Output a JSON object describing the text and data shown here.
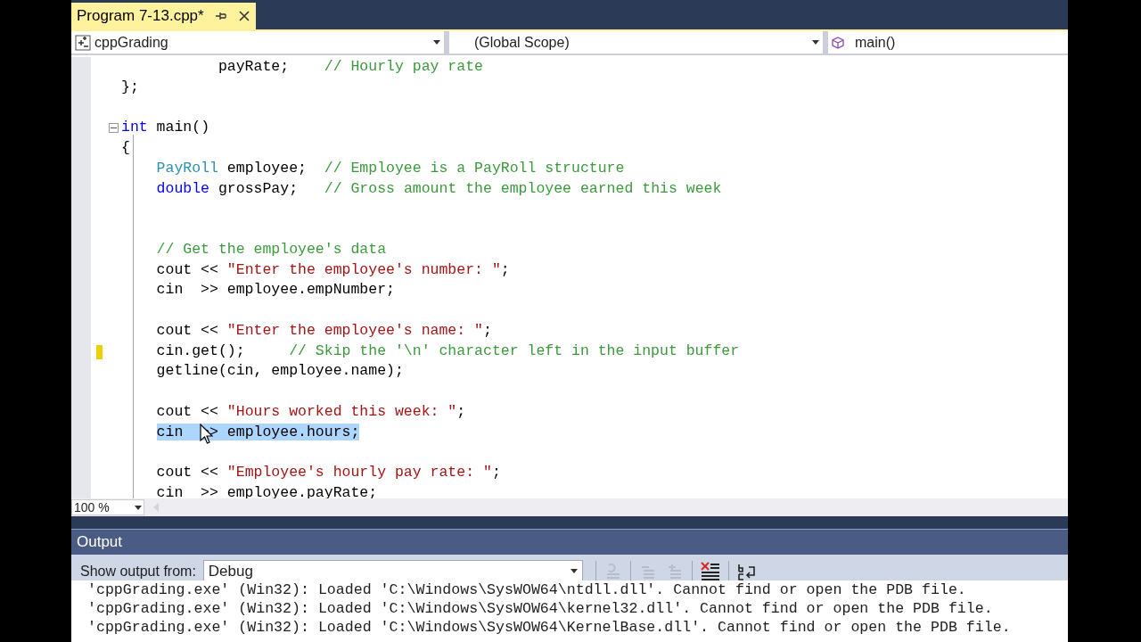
{
  "tab": {
    "title": "Program 7-13.cpp*",
    "selected": true
  },
  "nav": {
    "project": "cppGrading",
    "scope": "(Global Scope)",
    "member": "main()"
  },
  "code_lines": [
    {
      "segments": [
        {
          "kind": "plain",
          "text": "           payRate;    "
        },
        {
          "kind": "comment",
          "text": "// Hourly pay rate"
        }
      ],
      "fold": false,
      "changed": false,
      "selected": false
    },
    {
      "segments": [
        {
          "kind": "plain",
          "text": "};"
        }
      ],
      "fold": false,
      "changed": false,
      "selected": false
    },
    {
      "fold": false,
      "changed": false,
      "selected": false
    },
    {
      "segments": [
        {
          "kind": "keyword",
          "text": "int"
        },
        {
          "kind": "plain",
          "text": " main()"
        }
      ],
      "fold": true,
      "changed": false,
      "selected": false
    },
    {
      "segments": [
        {
          "kind": "plain",
          "text": "{"
        }
      ],
      "fold": false,
      "changed": false,
      "selected": false
    },
    {
      "segments": [
        {
          "kind": "type",
          "text": "    PayRoll"
        },
        {
          "kind": "plain",
          "text": " employee;  "
        },
        {
          "kind": "comment",
          "text": "// Employee is a PayRoll structure"
        }
      ],
      "fold": false,
      "changed": false,
      "selected": false
    },
    {
      "segments": [
        {
          "kind": "keyword",
          "text": "    double"
        },
        {
          "kind": "plain",
          "text": " grossPay;   "
        },
        {
          "kind": "comment",
          "text": "// Gross amount the employee earned this week"
        }
      ],
      "fold": false,
      "changed": false,
      "selected": false
    },
    {
      "fold": false,
      "changed": false,
      "selected": false
    },
    {
      "fold": false,
      "changed": false,
      "selected": false
    },
    {
      "segments": [
        {
          "kind": "comment",
          "text": "    // Get the employee's data"
        }
      ],
      "fold": false,
      "changed": false,
      "selected": false
    },
    {
      "segments": [
        {
          "kind": "plain",
          "text": "    cout << "
        },
        {
          "kind": "string",
          "text": "\"Enter the employee's number: \""
        },
        {
          "kind": "plain",
          "text": ";"
        }
      ],
      "fold": false,
      "changed": false,
      "selected": false
    },
    {
      "segments": [
        {
          "kind": "plain",
          "text": "    cin  >> employee.empNumber;"
        }
      ],
      "fold": false,
      "changed": false,
      "selected": false
    },
    {
      "fold": false,
      "changed": false,
      "selected": false
    },
    {
      "segments": [
        {
          "kind": "plain",
          "text": "    cout << "
        },
        {
          "kind": "string",
          "text": "\"Enter the employee's name: \""
        },
        {
          "kind": "plain",
          "text": ";"
        }
      ],
      "fold": false,
      "changed": false,
      "selected": false
    },
    {
      "segments": [
        {
          "kind": "plain",
          "text": "    cin.get();     "
        },
        {
          "kind": "comment",
          "text": "// Skip the '\\n' character left in the input buffer"
        }
      ],
      "fold": false,
      "changed": true,
      "selected": false
    },
    {
      "segments": [
        {
          "kind": "plain",
          "text": "    getline(cin, employee.name);"
        }
      ],
      "fold": false,
      "changed": false,
      "selected": false
    },
    {
      "fold": false,
      "changed": false,
      "selected": false
    },
    {
      "segments": [
        {
          "kind": "plain",
          "text": "    cout << "
        },
        {
          "kind": "string",
          "text": "\"Hours worked this week: \""
        },
        {
          "kind": "plain",
          "text": ";"
        }
      ],
      "fold": false,
      "changed": false,
      "selected": false
    },
    {
      "segments": [
        {
          "kind": "plain",
          "text": "    cin  >> employee.hours;"
        }
      ],
      "fold": false,
      "changed": false,
      "selected": true
    },
    {
      "fold": false,
      "changed": false,
      "selected": false
    },
    {
      "segments": [
        {
          "kind": "plain",
          "text": "    cout << "
        },
        {
          "kind": "string",
          "text": "\"Employee's hourly pay rate: \""
        },
        {
          "kind": "plain",
          "text": ";"
        }
      ],
      "fold": false,
      "changed": false,
      "selected": false
    },
    {
      "segments": [
        {
          "kind": "plain",
          "text": "    cin  >> employee.payRate;"
        }
      ],
      "fold": false,
      "changed": false,
      "selected": false
    }
  ],
  "zoom": "100 %",
  "output": {
    "title": "Output",
    "source_label": "Show output from:",
    "source": "Debug",
    "lines": [
      "'cppGrading.exe' (Win32): Loaded 'C:\\Windows\\SysWOW64\\ntdll.dll'. Cannot find or open the PDB file.",
      "'cppGrading.exe' (Win32): Loaded 'C:\\Windows\\SysWOW64\\kernel32.dll'. Cannot find or open the PDB file.",
      "'cppGrading.exe' (Win32): Loaded 'C:\\Windows\\SysWOW64\\KernelBase.dll'. Cannot find or open the PDB file."
    ]
  }
}
